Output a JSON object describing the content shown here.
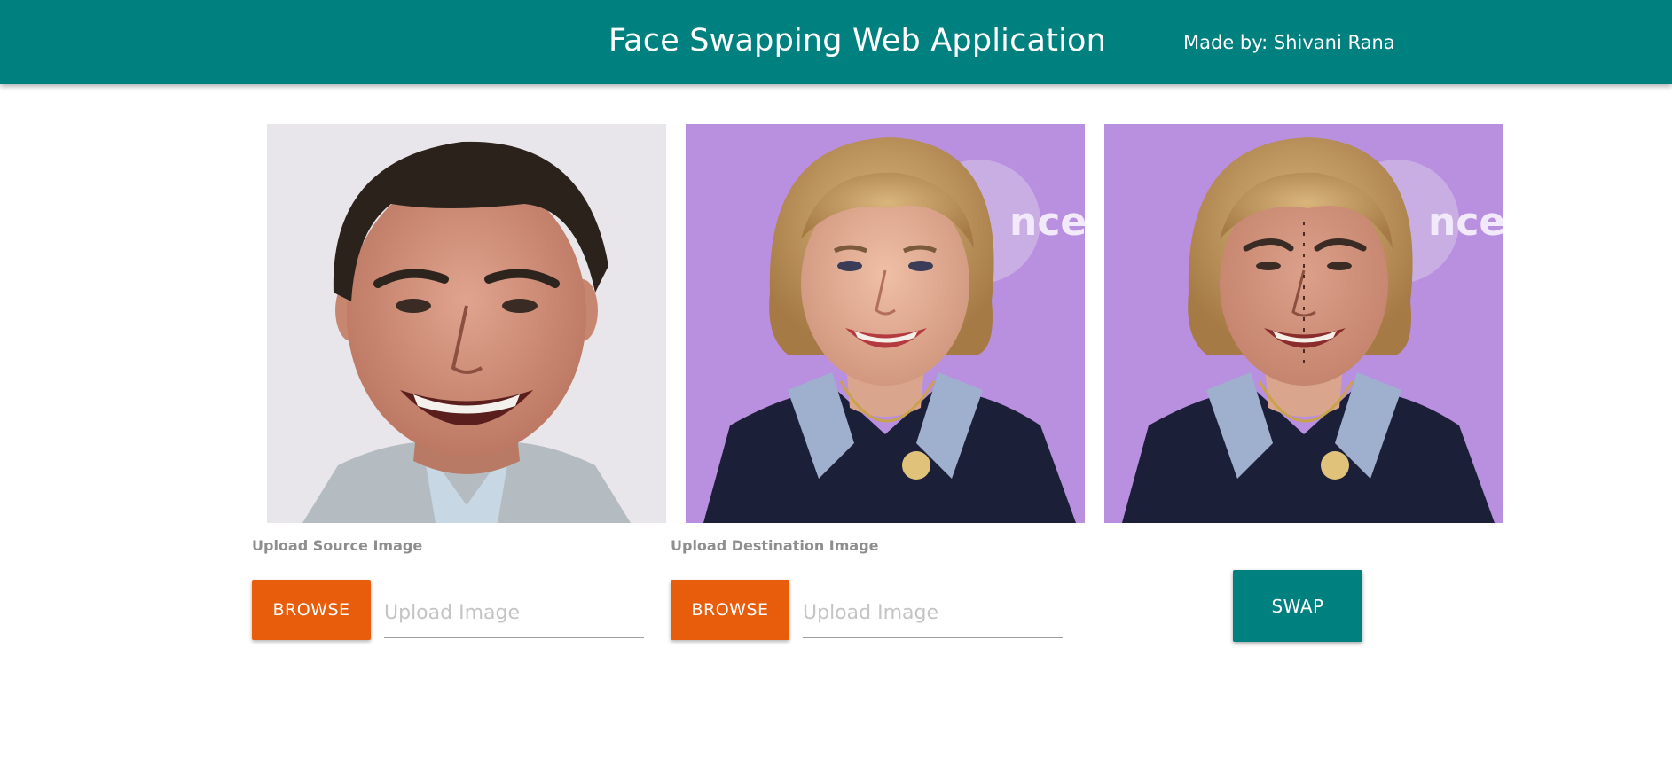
{
  "header": {
    "title": "Face Swapping Web Application",
    "author": "Made by: Shivani Rana",
    "background_color": "#00807f"
  },
  "panels": {
    "source": {
      "label": "Upload Source Image",
      "browse_label": "BROWSE",
      "input_placeholder": "Upload Image"
    },
    "destination": {
      "label": "Upload Destination Image",
      "browse_label": "BROWSE",
      "input_placeholder": "Upload Image",
      "backdrop_text": "nce"
    },
    "result": {
      "backdrop_text": "nce"
    }
  },
  "actions": {
    "swap_label": "SWAP"
  },
  "colors": {
    "accent_teal": "#00807f",
    "browse_orange": "#e85d0c",
    "label_gray": "#8e8e8e"
  }
}
